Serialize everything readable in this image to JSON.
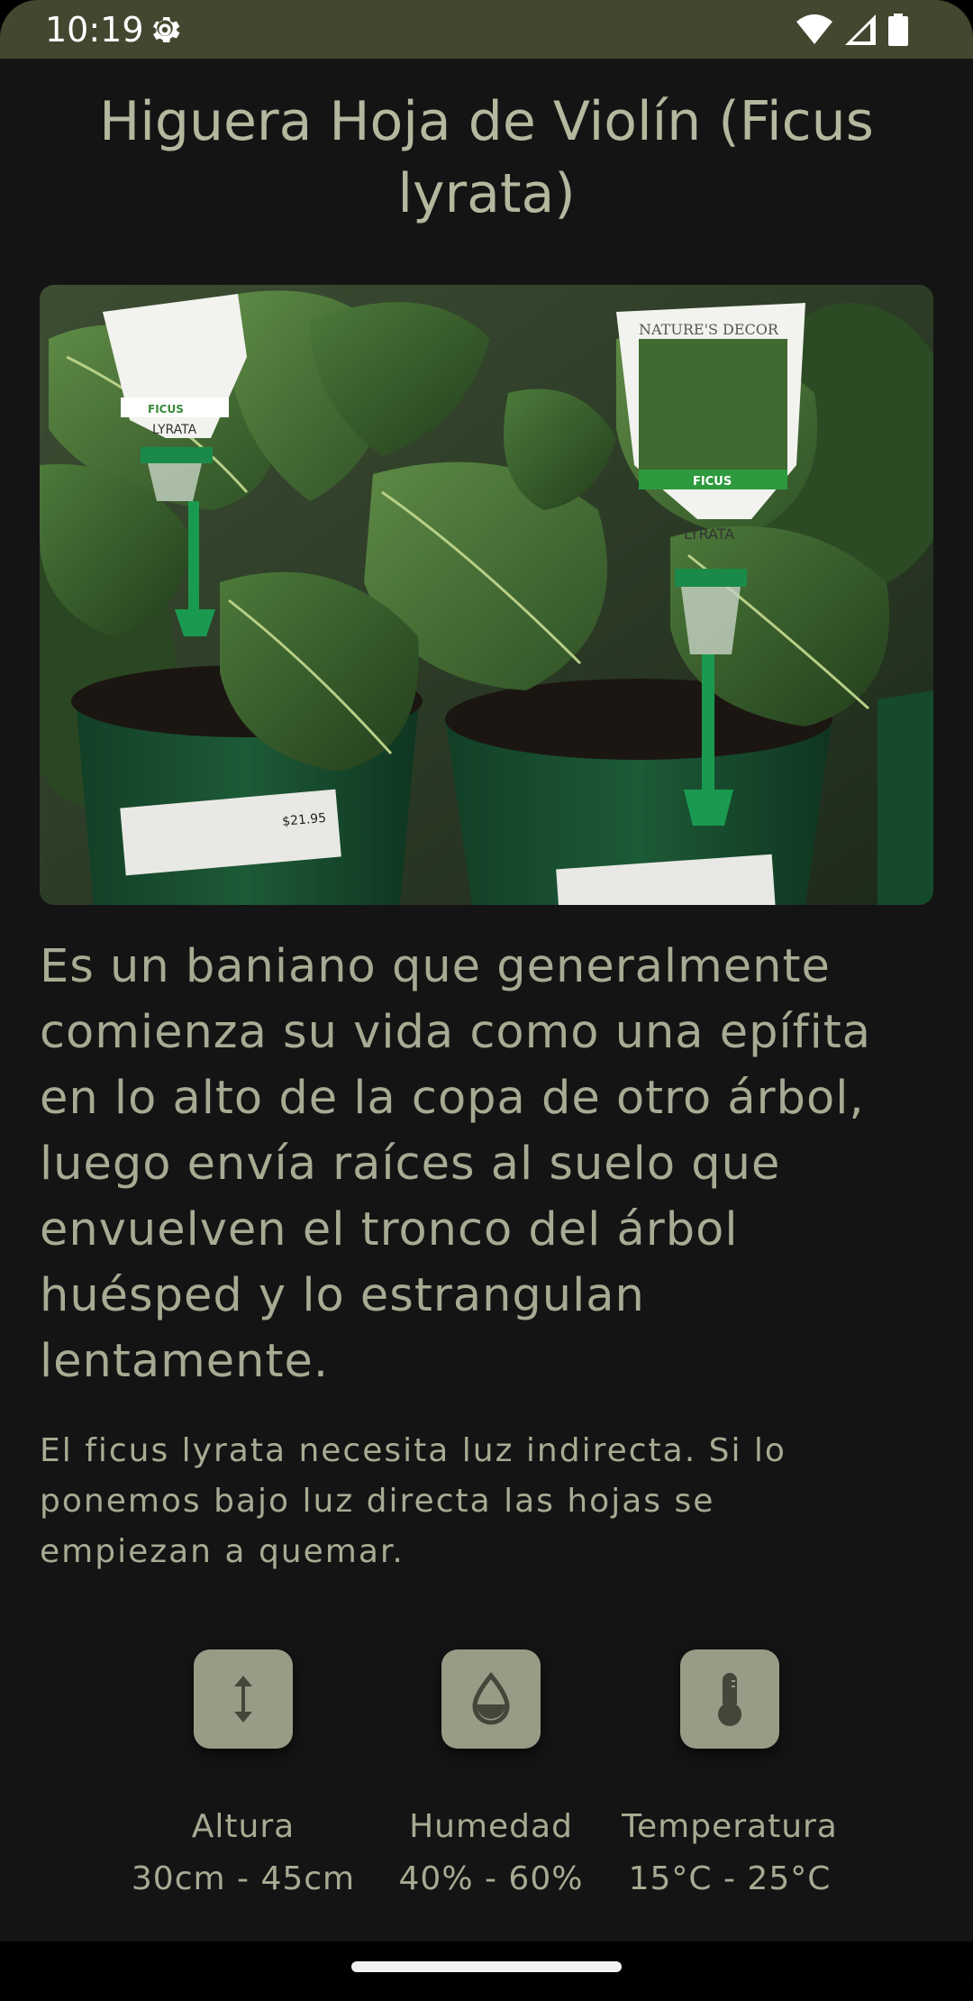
{
  "status_bar": {
    "time": "10:19",
    "icons": [
      "gear-icon",
      "wifi-icon",
      "signal-icon",
      "battery-icon"
    ]
  },
  "plant": {
    "title": "Higuera Hoja de Violín (Ficus lyrata)",
    "image_labels": {
      "left_tag_top": "FICUS",
      "left_tag": "LYRATA",
      "right_brand": "NATURE'S DECOR",
      "right_tag_top": "FICUS",
      "right_tag": "LYRATA",
      "price": "$21.95"
    },
    "description": "Es un baniano que generalmente comienza su vida como una epífita en lo alto de la copa de otro árbol, luego envía raíces al suelo que envuelven el tronco del árbol huésped y lo estrangulan lentamente.",
    "care_note": "El ficus lyrata necesita luz indirecta. Si lo ponemos bajo luz directa las hojas se empiezan a quemar."
  },
  "stats": [
    {
      "icon": "height-icon",
      "label": "Altura",
      "value": "30cm - 45cm"
    },
    {
      "icon": "humidity-icon",
      "label": "Humedad",
      "value": "40% - 60%"
    },
    {
      "icon": "temperature-icon",
      "label": "Temperatura",
      "value": "15°C - 25°C"
    }
  ],
  "colors": {
    "status_bar": "#44472f",
    "background": "#141414",
    "text": "#a8aa93",
    "icon_box": "#999b86"
  }
}
